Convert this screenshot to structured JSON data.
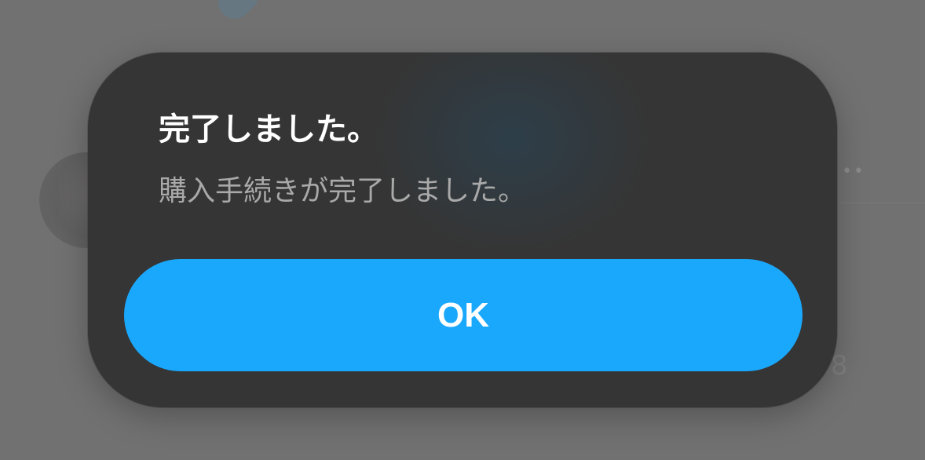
{
  "background": {
    "more_glyph": "••",
    "digit": "8"
  },
  "alert": {
    "title": "完了しました。",
    "message": "購入手続きが完了しました。",
    "ok_label": "OK"
  },
  "colors": {
    "overlay": "#717171",
    "dialog": "#353535",
    "button": "#1aa8fd",
    "title_text": "#ffffff",
    "message_text": "#a9a9a9"
  }
}
